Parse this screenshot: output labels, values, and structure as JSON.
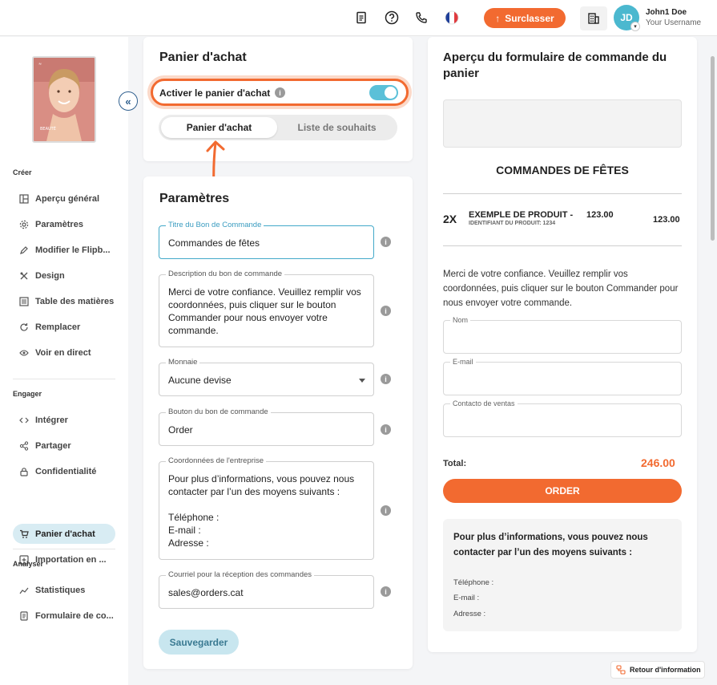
{
  "topbar": {
    "upgrade_label": "Surclasser",
    "avatar_initials": "JD",
    "user_name": "John1 Doe",
    "user_sub": "Your Username"
  },
  "sidebar": {
    "sections": {
      "create": "Créer",
      "engage": "Engager",
      "analyze": "Analyser"
    },
    "items": [
      {
        "label": "Aperçu général",
        "icon": "layout-icon"
      },
      {
        "label": "Paramètres",
        "icon": "gear-icon"
      },
      {
        "label": "Modifier le Flipb...",
        "icon": "pencil-icon"
      },
      {
        "label": "Design",
        "icon": "design-icon"
      },
      {
        "label": "Table des matières",
        "icon": "list-icon"
      },
      {
        "label": "Remplacer",
        "icon": "refresh-icon"
      },
      {
        "label": "Voir en direct",
        "icon": "eye-icon"
      },
      {
        "label": "Intégrer",
        "icon": "code-icon"
      },
      {
        "label": "Partager",
        "icon": "share-icon"
      },
      {
        "label": "Confidentialité",
        "icon": "lock-icon"
      },
      {
        "label": "Panier d'achat",
        "icon": "cart-icon"
      },
      {
        "label": "Importation en ...",
        "icon": "import-icon"
      },
      {
        "label": "Statistiques",
        "icon": "chart-icon"
      },
      {
        "label": "Formulaire de co...",
        "icon": "form-icon"
      }
    ],
    "cover_text": "BEAUTÉ"
  },
  "cart_card": {
    "title": "Panier d'achat",
    "toggle_label": "Activer le panier d'achat",
    "tab_cart": "Panier d'achat",
    "tab_wishlist": "Liste de souhaits"
  },
  "settings": {
    "title": "Paramètres",
    "order_title_label": "Titre du Bon de Commande",
    "order_title_value": "Commandes de fêtes",
    "description_label": "Description du bon de commande",
    "description_value": "Merci de votre confiance. Veuillez remplir vos coordonnées, puis cliquer sur le bouton Commander pour nous envoyer votre commande.",
    "currency_label": "Monnaie",
    "currency_value": "Aucune devise",
    "button_label": "Bouton du bon de commande",
    "button_value": "Order",
    "company_label": "Coordonnées de l'entreprise",
    "company_value": "Pour plus d’informations, vous pouvez nous contacter par l’un des moyens suivants :\n\nTéléphone :\nE-mail :\nAdresse :",
    "email_label": "Courriel pour la réception des commandes",
    "email_value": "sales@orders.cat",
    "save_label": "Sauvegarder"
  },
  "preview": {
    "title": "Aperçu du formulaire de commande du panier",
    "heading": "COMMANDES DE FÊTES",
    "qty": "2X",
    "product_name": "EXEMPLE DE PRODUIT -",
    "product_unit_price": "123.00",
    "product_id": "IDENTIFIANT DU PRODUIT: 1234",
    "product_total": "123.00",
    "description": "Merci de votre confiance. Veuillez remplir vos coordonnées, puis cliquer sur le bouton Commander pour nous envoyer votre commande.",
    "field_name": "Nom",
    "field_email": "E-mail",
    "field_contact": "Contacto de ventas",
    "total_label": "Total:",
    "total_value": "246.00",
    "order_button": "ORDER",
    "contact_heading": "Pour plus d’informations, vous pouvez nous contacter par l’un des moyens suivants :",
    "contact_phone": "Téléphone :",
    "contact_email": "E-mail :",
    "contact_address": "Adresse :"
  },
  "footer": {
    "retour_label": "Retour d'information"
  },
  "colors": {
    "accent": "#f26a30",
    "teal": "#5bc0d8",
    "active_nav": "#d8ecf3"
  }
}
